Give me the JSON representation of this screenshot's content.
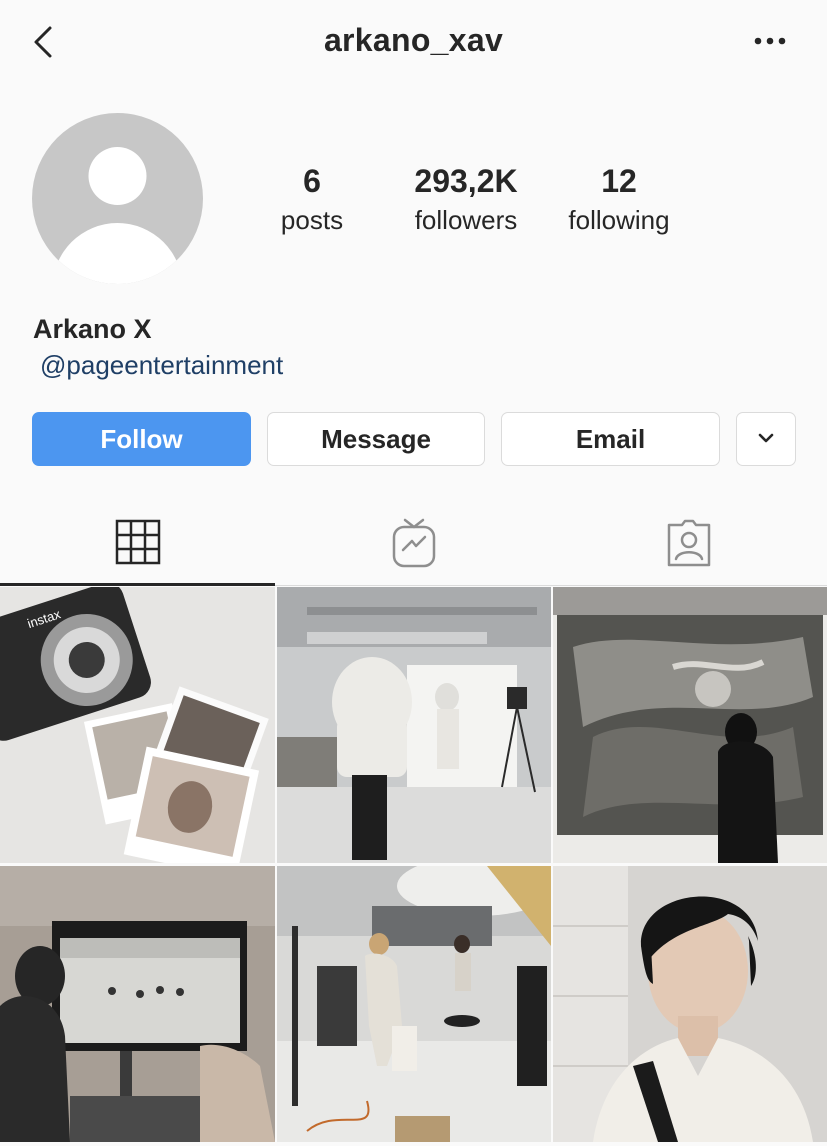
{
  "header": {
    "username": "arkano_xav",
    "back_icon": "chevron-left-icon",
    "more_icon": "ellipsis-icon"
  },
  "profile": {
    "avatar_icon": "default-avatar-icon",
    "stats": [
      {
        "value": "6",
        "label": "posts"
      },
      {
        "value": "293,2K",
        "label": "followers"
      },
      {
        "value": "12",
        "label": "following"
      }
    ],
    "display_name": "Arkano X",
    "bio_link": "@pageentertainment"
  },
  "actions": {
    "follow_label": "Follow",
    "message_label": "Message",
    "email_label": "Email",
    "more_icon": "chevron-down-icon"
  },
  "tabs": [
    {
      "icon": "grid-icon",
      "active": true
    },
    {
      "icon": "igtv-icon",
      "active": false
    },
    {
      "icon": "tagged-icon",
      "active": false
    }
  ],
  "posts": [
    {
      "subject": "instax camera with polaroid photos",
      "camera_brand": "instax"
    },
    {
      "subject": "photo studio shoot with white backdrop"
    },
    {
      "subject": "person in front of large artwork"
    },
    {
      "subject": "monitor showing dance rehearsal"
    },
    {
      "subject": "behind the scenes studio crew"
    },
    {
      "subject": "portrait selfie"
    }
  ],
  "colors": {
    "follow_button": "#4c96f0",
    "link": "#1f3f66",
    "text": "#262626",
    "background": "#fafafa"
  }
}
